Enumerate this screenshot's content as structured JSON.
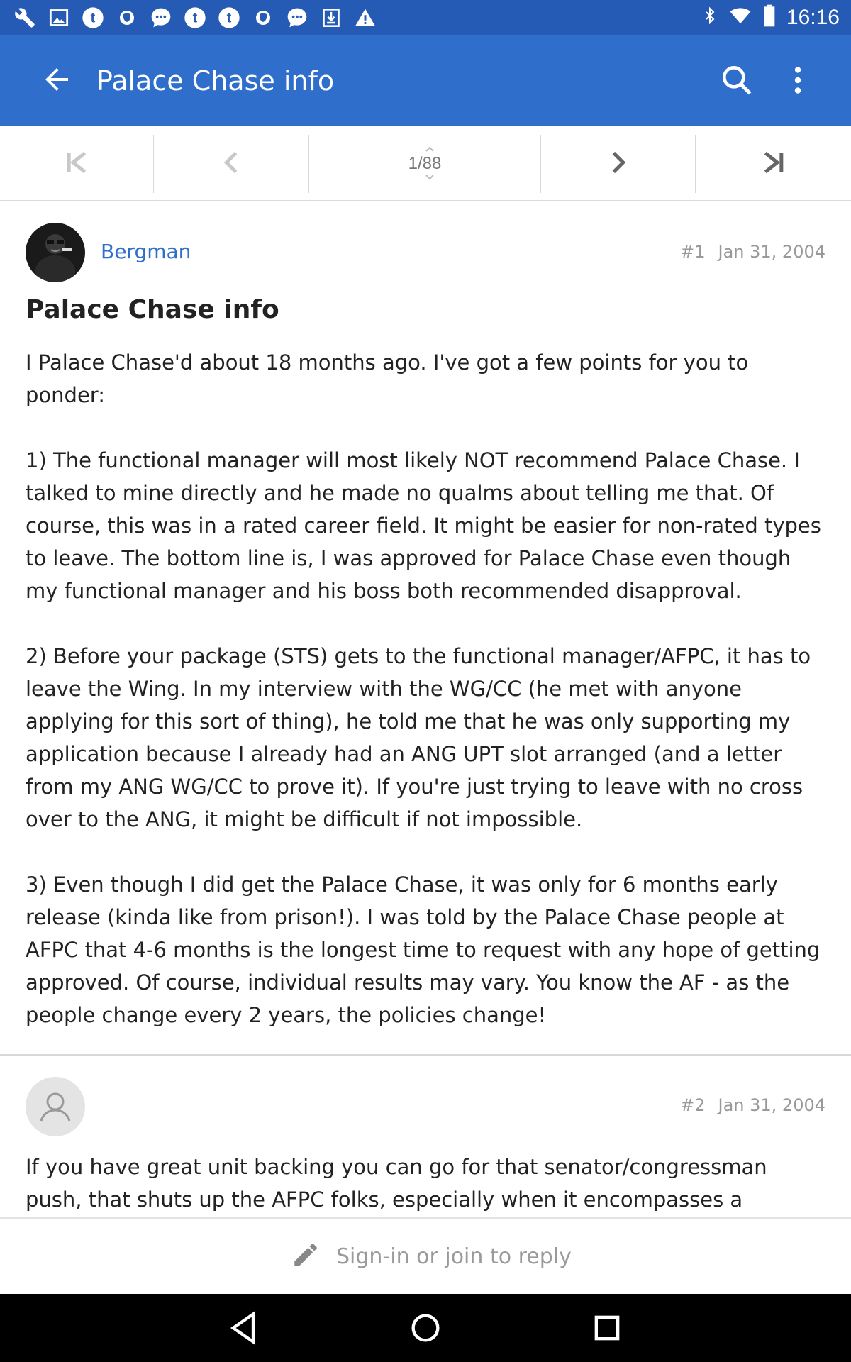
{
  "status_bar": {
    "time": "16:16",
    "notification_icons": [
      "wrench-icon",
      "image-icon",
      "tumblr-icon",
      "shield-icon",
      "chat-icon",
      "tumblr-icon",
      "tumblr-icon",
      "shield-icon",
      "chat-icon",
      "download-icon",
      "warning-icon"
    ],
    "system_icons": [
      "bluetooth-icon",
      "wifi-icon",
      "battery-icon"
    ]
  },
  "app_bar": {
    "title": "Palace Chase info",
    "accent_color": "#2f6fcb"
  },
  "pager": {
    "current_page": "1/88"
  },
  "posts": [
    {
      "username": "Bergman",
      "number": "#1",
      "date": "Jan 31, 2004",
      "title": "Palace Chase info",
      "paragraphs": [
        "I Palace Chase'd about 18 months ago. I've got a few points for you to ponder:",
        "1) The functional manager will most likely NOT recommend Palace Chase. I talked to mine directly and he made no qualms about telling me that. Of course, this was in a rated career field. It might be easier for non-rated types to leave. The bottom line is, I was approved for Palace Chase even though my functional manager and his boss both recommended disapproval.",
        "2) Before your package (STS) gets to the functional manager/AFPC, it has to leave the Wing. In my interview with the WG/CC (he met with anyone applying for this sort of thing), he told me that he was only supporting my application because I already had an ANG UPT slot arranged (and a letter from my ANG WG/CC to prove it). If you're just trying to leave with no cross over to the ANG, it might be difficult if not impossible.",
        "3) Even though I did get the Palace Chase, it was only for 6 months early release (kinda like from prison!). I was told by the Palace Chase people at AFPC that 4-6 months is the longest time to request with any hope of getting approved. Of course, individual results may vary. You know the AF - as the people change every 2 years, the policies change!"
      ]
    },
    {
      "username": "",
      "number": "#2",
      "date": "Jan 31, 2004",
      "paragraphs": [
        "If you have great unit backing you can go for that senator/congressman push, that shuts up the AFPC folks, especially when it encompasses a congressional"
      ]
    }
  ],
  "reply_bar": {
    "label": "Sign-in or join to reply"
  }
}
